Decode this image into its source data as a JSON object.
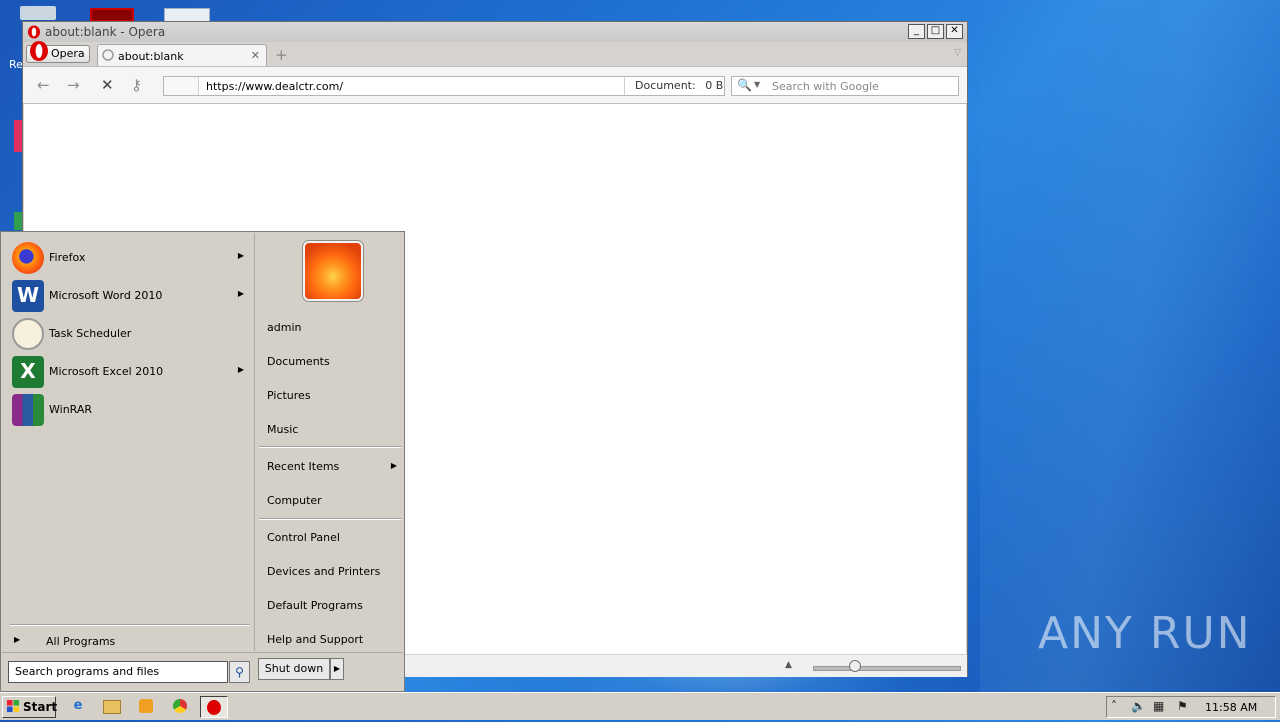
{
  "desktop": {
    "watermark": "ANY RUN",
    "partial_icon_label": "Re"
  },
  "window": {
    "title": "about:blank - Opera",
    "minimize": "_",
    "maximize": "□",
    "close": "✕"
  },
  "tabs": {
    "menu_label": "Opera",
    "active_tab": "about:blank",
    "tab_close": "✕",
    "new_tab": "+",
    "tab_menu": "▽"
  },
  "toolbar": {
    "back": "←",
    "forward": "→",
    "stop": "✕",
    "key": "⚷",
    "url": "https://www.dealctr.com/",
    "document_label": "Document:",
    "document_size": "0 B",
    "search_placeholder": "Search with Google"
  },
  "statusbar": {
    "zoom_arrow": "▲"
  },
  "start_menu": {
    "programs": [
      {
        "label": "Firefox",
        "has_submenu": true
      },
      {
        "label": "Microsoft Word 2010",
        "has_submenu": true
      },
      {
        "label": "Task Scheduler",
        "has_submenu": false
      },
      {
        "label": "Microsoft Excel 2010",
        "has_submenu": true
      },
      {
        "label": "WinRAR",
        "has_submenu": false
      }
    ],
    "all_programs": "All Programs",
    "right_items": {
      "user": "admin",
      "documents": "Documents",
      "pictures": "Pictures",
      "music": "Music",
      "recent_items": "Recent Items",
      "computer": "Computer",
      "control_panel": "Control Panel",
      "devices_printers": "Devices and Printers",
      "default_programs": "Default Programs",
      "help_support": "Help and Support"
    },
    "search_placeholder": "Search programs and files",
    "shutdown": "Shut down",
    "submenu_arrow": "▶"
  },
  "taskbar": {
    "start": "Start",
    "clock": "11:58 AM"
  }
}
